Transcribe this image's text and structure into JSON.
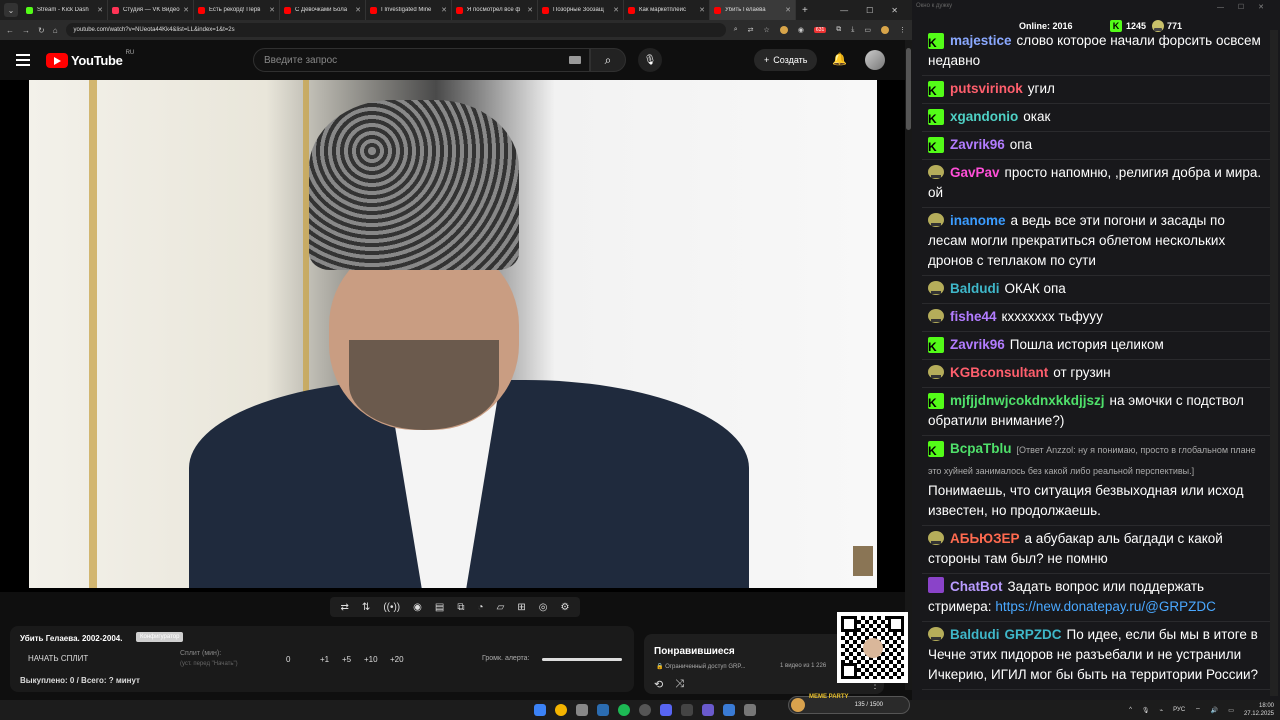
{
  "browser": {
    "tabs": [
      {
        "label": "Stream - Kick Dash",
        "color": "#53fc18",
        "active": false
      },
      {
        "label": "Студия — VK Видео",
        "color": "#ff3355",
        "active": false
      },
      {
        "label": "Есть рекорд! Перв",
        "color": "#ff0000",
        "active": false
      },
      {
        "label": "С Девочками Бола",
        "color": "#ff0000",
        "active": false
      },
      {
        "label": "I Investigated Mine",
        "color": "#ff0000",
        "active": false
      },
      {
        "label": "Я посмотрел все ф",
        "color": "#ff0000",
        "active": false
      },
      {
        "label": "Позорные Зоозащ",
        "color": "#ff0000",
        "active": false
      },
      {
        "label": "Как маркетплейс",
        "color": "#ff0000",
        "active": false
      },
      {
        "label": "Убить Гелаева",
        "color": "#ff0000",
        "active": true
      }
    ],
    "url": "youtube.com/watch?v=NUeota44Kk4&list=LL&index=1&t=2s",
    "ext_badge": "631"
  },
  "youtube": {
    "logo_text": "YouTube",
    "logo_region": "RU",
    "search_placeholder": "Введите запрос",
    "create_label": "Создать"
  },
  "split_panel": {
    "title": "Убить Гелаева. 2002-2004.",
    "badge": "Конфигуратор",
    "start_label": "НАЧАТЬ СПЛИТ",
    "split_label": "Сплит (мин):",
    "split_hint": "(уст. перед \"Начать\")",
    "current": "0",
    "increments": [
      "+1",
      "+5",
      "+10",
      "+20"
    ],
    "alert_label": "Громк. алерта:",
    "alert_volume": 1.0,
    "summary": "Выкуплено: 0 / Всего: ? минут"
  },
  "liked_panel": {
    "title": "Понравившиеся",
    "access": "Ограниченный доступ GRP...",
    "count": "1 видео из 1 226"
  },
  "chat": {
    "window_title": "Окно к дужку",
    "online_label": "Online:",
    "online_count": "2016",
    "kick_count": "1245",
    "twitch_count": "771",
    "messages": [
      {
        "platform": "kick",
        "nick": "majestice",
        "color": "#8aa8ff",
        "text": "слово которое начали форсить освсем недавно"
      },
      {
        "platform": "kick",
        "nick": "putsvirinok",
        "color": "#ff5f6d",
        "text": "угил"
      },
      {
        "platform": "kick",
        "nick": "xgandonio",
        "color": "#4fd1c5",
        "text": "окак"
      },
      {
        "platform": "kick",
        "nick": "Zavrik96",
        "color": "#b27cff",
        "text": "опа"
      },
      {
        "platform": "twitch",
        "nick": "GavPav",
        "color": "#ff4fd8",
        "text": "просто напомню, ,религия добра и мира. ой"
      },
      {
        "platform": "twitch",
        "nick": "inanome",
        "color": "#3b9cff",
        "text": "а ведь все эти погони и засады по лесам могли прекратиться облетом нескольких дронов с теплаком по сути"
      },
      {
        "platform": "twitch",
        "nick": "Baldudi",
        "color": "#3fb7c9",
        "text": "ОКАК опа"
      },
      {
        "platform": "twitch",
        "nick": "fishe44",
        "color": "#b27cff",
        "text": "кххххххх тьфууу"
      },
      {
        "platform": "kick",
        "nick": "Zavrik96",
        "color": "#b27cff",
        "text": "Пошла история целиком"
      },
      {
        "platform": "twitch",
        "nick": "KGBconsultant",
        "color": "#ff5f6d",
        "text": "от грузин"
      },
      {
        "platform": "kick",
        "nick": "mjfjjdnwjcokdnxkkdjjszj",
        "color": "#4fe06a",
        "text": "на эмочки с подствол обратили внимание?)"
      },
      {
        "platform": "kick",
        "nick": "BcpaTblu",
        "color": "#4fe06a",
        "reply": "[Ответ Anzzol: ну я понимаю, просто в глобальном плане это хуйней занималось без какой либо реальной перспективы.]",
        "text": "Понимаешь, что ситуация безвыходная или исход известен, но продолжаешь."
      },
      {
        "platform": "twitch",
        "nick": "АБЬЮЗЕР",
        "color": "#ff6a4f",
        "text": "а абубакар аль багдади с какой стороны там был? не помню"
      },
      {
        "platform": "bot",
        "nick": "ChatBot",
        "color": "#b99cff",
        "text": "Задать вопрос или поддержать стримера:",
        "link": "https://new.donatepay.ru/@GRPZDC"
      },
      {
        "platform": "twitch",
        "nick": "Baldudi",
        "color": "#3fb7c9",
        "mention": "GRPZDC",
        "text": "По идее, если бы мы в итоге в Чечне этих пидоров не разъебали и не устранили Ичкерию, ИГИЛ мог бы быть на территории России?"
      }
    ]
  },
  "overlay": {
    "meme_party": "MEME PARTY",
    "meme_counter": "135 / 1500"
  },
  "taskbar": {
    "lang": "РУС",
    "time": "18:00",
    "date": "27.12.2025"
  }
}
